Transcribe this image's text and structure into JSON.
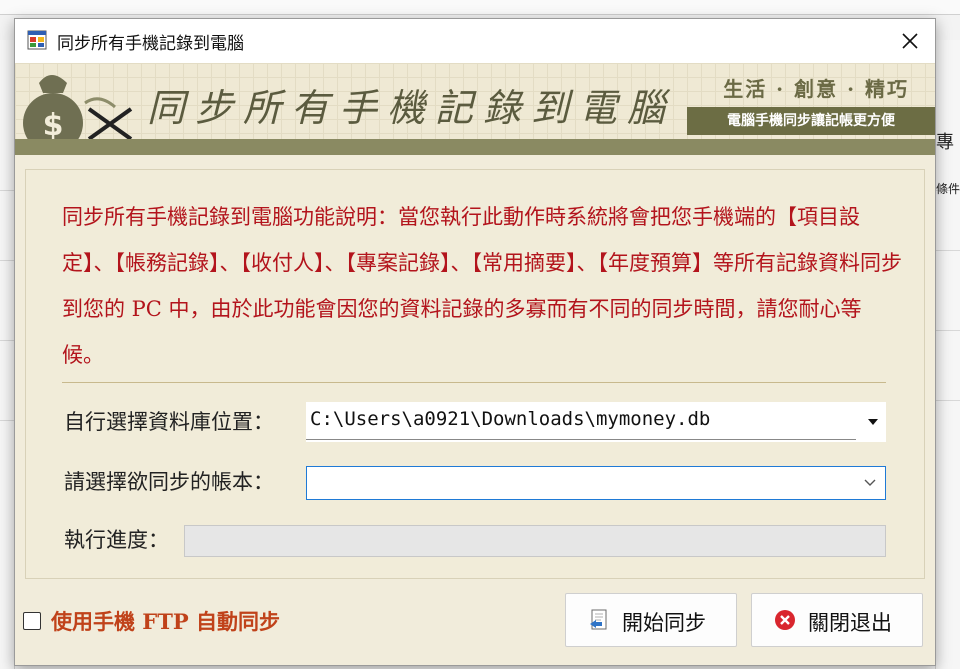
{
  "window": {
    "title": "同步所有手機記錄到電腦"
  },
  "banner": {
    "title": "同步所有手機記錄到電腦",
    "slogan": "生活 · 創意 · 精巧",
    "tagline": "電腦手機同步讓記帳更方便"
  },
  "background": {
    "right_tab": "專",
    "right_tab2": "條件"
  },
  "description": "同步所有手機記錄到電腦功能說明：當您執行此動作時系統將會把您手機端的【項目設定】、【帳務記錄】、【收付人】、【專案記錄】、【常用摘要】、【年度預算】等所有記錄資料同步到您的 PC 中，由於此功能會因您的資料記錄的多寡而有不同的同步時間，請您耐心等候。",
  "form": {
    "db_label": "自行選擇資料庫位置：",
    "db_value": "C:\\Users\\a0921\\Downloads\\mymoney.db",
    "book_label": "請選擇欲同步的帳本：",
    "book_value": "",
    "progress_label": "執行進度：",
    "progress": 0
  },
  "footer": {
    "ftp_label": "使用手機 FTP 自動同步",
    "ftp_checked": false,
    "start_label": "開始同步",
    "close_label": "關閉退出"
  },
  "colors": {
    "description_text": "#b3141c",
    "ftp_label": "#c0421a",
    "banner_tag_bg": "#6c6d44",
    "select_focus_border": "#1f7ad6"
  }
}
